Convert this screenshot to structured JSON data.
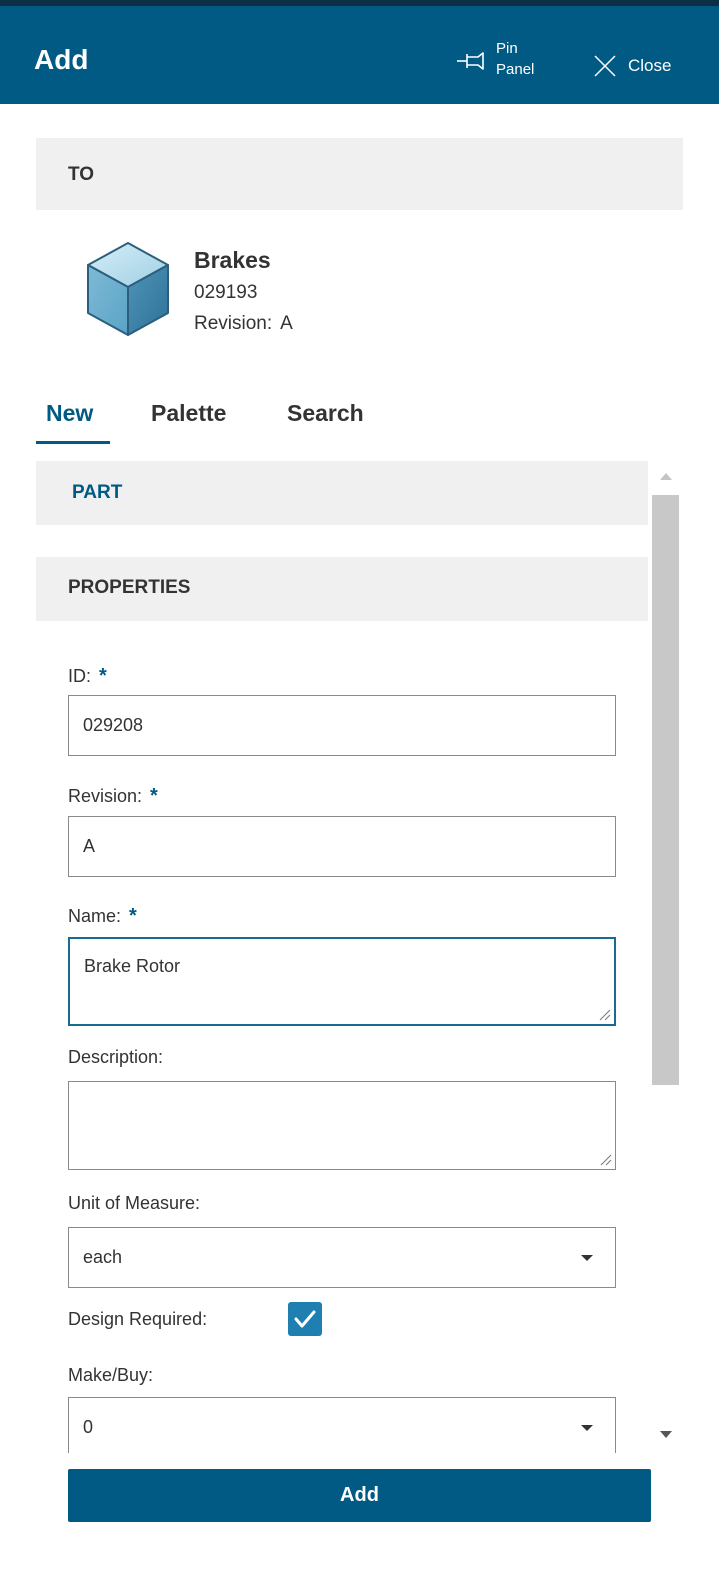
{
  "header": {
    "title": "Add",
    "pin_line1": "Pin",
    "pin_line2": "Panel",
    "close_label": "Close"
  },
  "to_section": {
    "label": "TO",
    "item": {
      "name": "Brakes",
      "number": "029193",
      "revision_label": "Revision:",
      "revision_value": "A",
      "icon": "cube-icon"
    }
  },
  "tabs": [
    {
      "label": "New",
      "active": true
    },
    {
      "label": "Palette",
      "active": false
    },
    {
      "label": "Search",
      "active": false
    }
  ],
  "sections": {
    "part": "PART",
    "properties": "PROPERTIES"
  },
  "form": {
    "id": {
      "label": "ID:",
      "required": "*",
      "value": "029208"
    },
    "revision": {
      "label": "Revision:",
      "required": "*",
      "value": "A"
    },
    "name": {
      "label": "Name:",
      "required": "*",
      "value": "Brake Rotor"
    },
    "description": {
      "label": "Description:",
      "value": ""
    },
    "unit_of_measure": {
      "label": "Unit of Measure:",
      "value": "each"
    },
    "design_required": {
      "label": "Design Required:",
      "checked": true
    },
    "make_buy": {
      "label": "Make/Buy:",
      "value": "0"
    }
  },
  "add_button": "Add",
  "colors": {
    "header": "#005a83",
    "accent": "#005a83",
    "checkbox": "#1f7fb0",
    "section_bg": "#f0f0f0"
  }
}
